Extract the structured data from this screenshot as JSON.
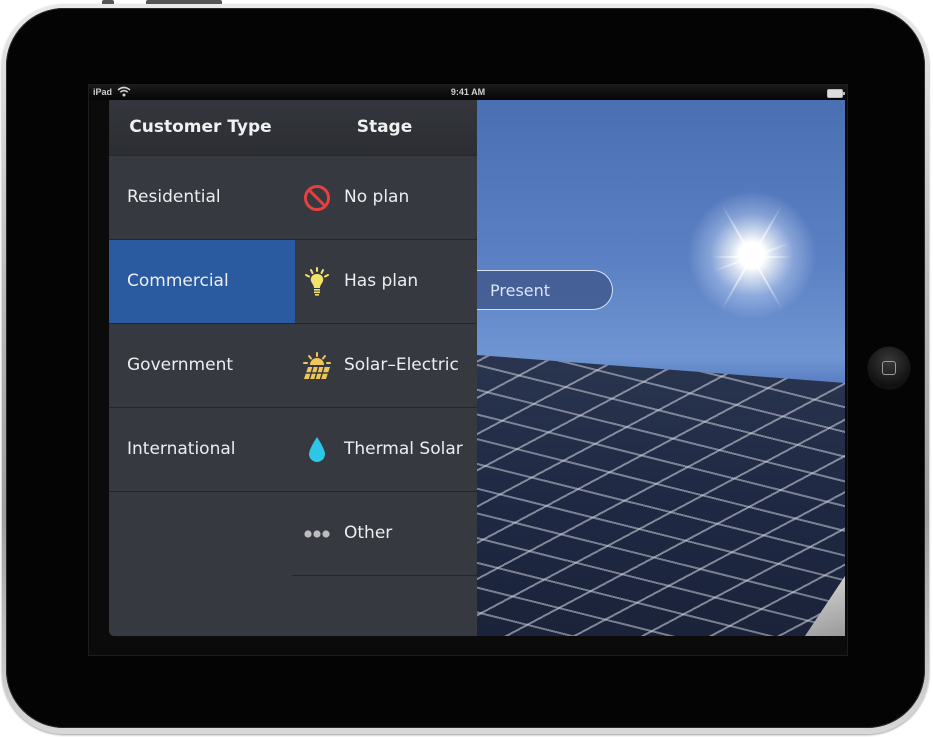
{
  "device": {
    "type": "iPad"
  },
  "status_bar": {
    "carrier": "iPad",
    "wifi_icon": "wifi-icon",
    "time": "9:41 AM",
    "battery_icon": "battery-icon"
  },
  "menu": {
    "customer_type": {
      "header": "Customer Type",
      "items": [
        {
          "label": "Residential",
          "selected": false
        },
        {
          "label": "Commercial",
          "selected": true
        },
        {
          "label": "Government",
          "selected": false
        },
        {
          "label": "International",
          "selected": false
        }
      ]
    },
    "stage": {
      "header": "Stage",
      "items": [
        {
          "label": "No plan",
          "icon": "no-entry-icon",
          "color": "#e84040"
        },
        {
          "label": "Has plan",
          "icon": "lightbulb-icon",
          "color": "#f3e26a"
        },
        {
          "label": "Solar–Electric",
          "icon": "solar-panel-sun-icon",
          "color": "#f0c65a"
        },
        {
          "label": "Thermal Solar",
          "icon": "water-drop-icon",
          "color": "#2ec6e6"
        },
        {
          "label": "Other",
          "icon": "more-dots-icon",
          "color": "#bdbdbd"
        }
      ]
    },
    "selected_color": "#2a5a9f"
  },
  "present_button": {
    "label": "Present"
  },
  "home_button": {
    "icon": "home-button-icon"
  }
}
